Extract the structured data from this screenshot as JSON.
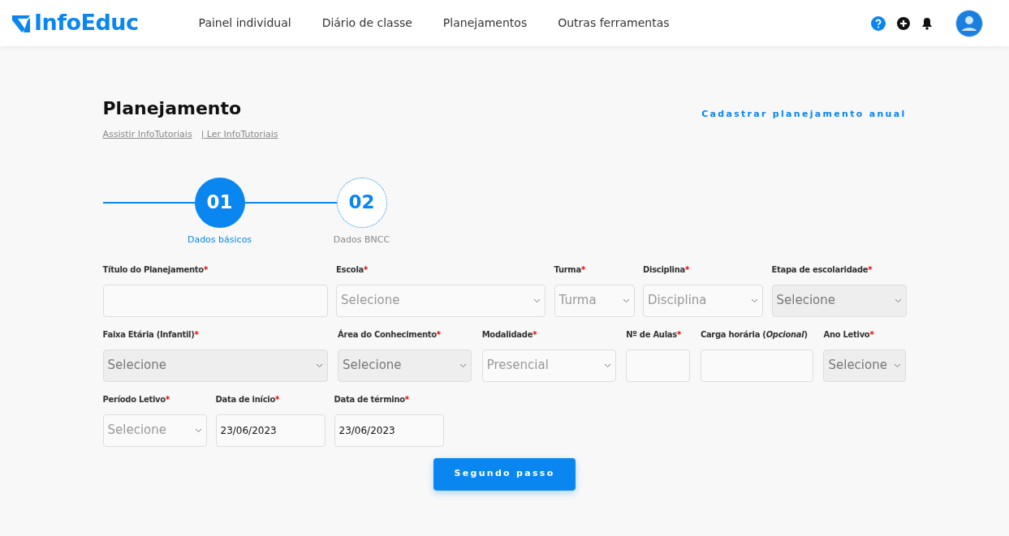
{
  "navbar": {
    "logo": "InfoEduc",
    "links": [
      "Painel individual",
      "Diário de classe",
      "Planejamentos",
      "Outras ferramentas"
    ]
  },
  "header": {
    "title": "Planejamento",
    "tutorial_links": [
      "Assistir InfoTutoriais",
      "| Ler InfoTutoriais"
    ],
    "action_link": "Cadastrar planejamento anual"
  },
  "steps": [
    {
      "number": "01",
      "label": "Dados básicos",
      "selected": true
    },
    {
      "number": "02",
      "label": "Dados BNCC",
      "selected": false
    }
  ],
  "form_rows": [
    [
      {
        "label": "Título do Planejamento",
        "required_mark": "*",
        "kind": "text",
        "disabled": false
      },
      {
        "label": "Escola",
        "required_mark": "*",
        "kind": "select",
        "placeholder": "Selecione",
        "disabled": false
      },
      {
        "label": "Turma",
        "required_mark": "*",
        "kind": "select",
        "placeholder": "Turma",
        "disabled": false
      },
      {
        "label": "Disciplina",
        "required_mark": "*",
        "kind": "select",
        "placeholder": "Disciplina",
        "disabled": false
      },
      {
        "label": "Etapa de escolaridade",
        "required_mark": "*",
        "kind": "select",
        "placeholder": "Selecione",
        "disabled": true
      }
    ],
    [
      {
        "label": "Faixa Etária (Infantil)",
        "required_mark": "*",
        "kind": "select",
        "placeholder": "Selecione",
        "disabled": true
      },
      {
        "label": "Área do Conhecimento",
        "required_mark": "*",
        "kind": "select",
        "placeholder": "Selecione",
        "disabled": true
      },
      {
        "label": "Modalidade",
        "required_mark": "*",
        "kind": "select",
        "placeholder": "Presencial",
        "disabled": false
      },
      {
        "label": "Nº de Aulas",
        "required_mark": "*",
        "kind": "text",
        "disabled": false
      },
      {
        "label": "Carga horária (*Opcional*)",
        "kind": "text",
        "disabled": false
      },
      {
        "label": "Ano Letivo",
        "required_mark": "*",
        "kind": "select",
        "placeholder": "Selecione",
        "disabled": true
      }
    ],
    [
      {
        "label": "Período Letivo",
        "required_mark": "*",
        "kind": "select",
        "placeholder": "Selecione",
        "disabled": false
      },
      {
        "label": "Data de início",
        "required_mark": "*",
        "kind": "date",
        "value": "23/06/2023",
        "disabled": false
      },
      {
        "label": "Data de término",
        "required_mark": "*",
        "kind": "date",
        "value": "23/06/2023",
        "disabled": false
      }
    ]
  ],
  "submit_button": "Segundo passo"
}
